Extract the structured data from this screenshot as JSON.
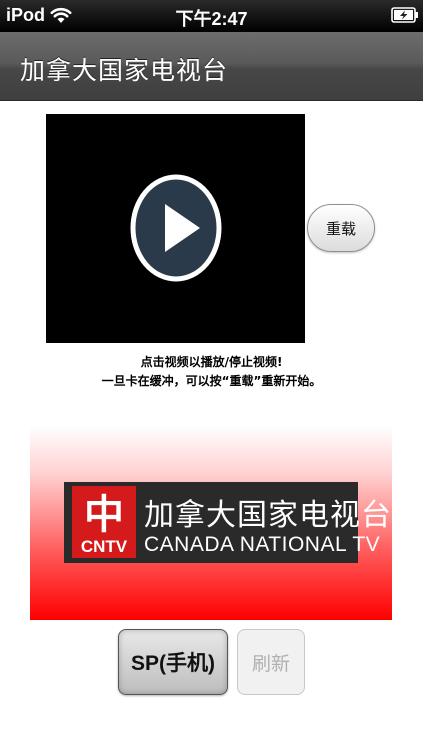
{
  "status_bar": {
    "carrier": "iPod",
    "time": "下午2:47",
    "wifi_icon": "wifi-icon",
    "battery_icon": "battery-charging-icon"
  },
  "header": {
    "title": "加拿大国家电视台"
  },
  "video": {
    "play_icon": "play-icon",
    "reload_label": "重载"
  },
  "hints": {
    "line1": "点击视频以播放/停止视频!",
    "line2": "一旦卡在缓冲，可以按“重载”重新开始。"
  },
  "banner": {
    "seal_char": "中",
    "seal_text": "CNTV",
    "chinese_name": "加拿大国家电视台",
    "english_name": "CANADA NATIONAL TV"
  },
  "buttons": {
    "sp_label": "SP(手机)",
    "refresh_label": "刷新"
  },
  "colors": {
    "banner_red": "#ff0000",
    "title_bar": "#555555",
    "video_bg": "#000000"
  }
}
